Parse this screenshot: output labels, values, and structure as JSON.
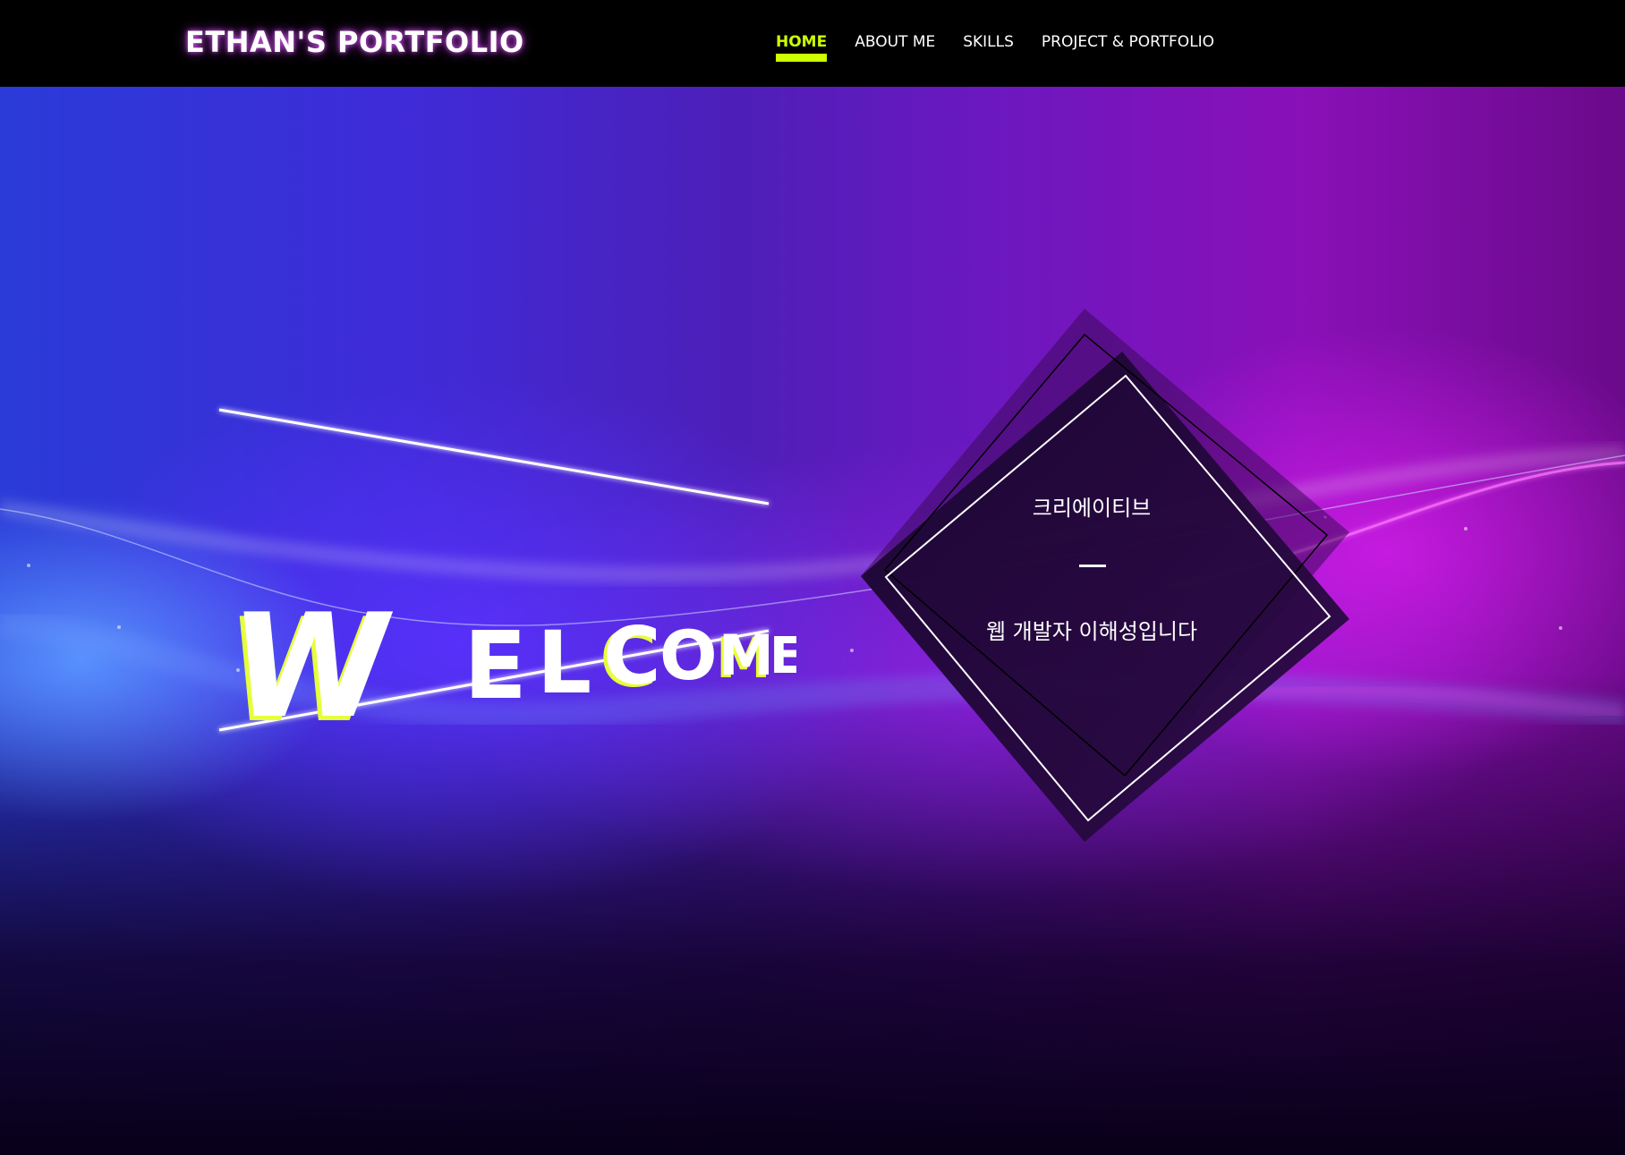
{
  "header": {
    "logo": "ETHAN'S PORTFOLIO",
    "nav": [
      {
        "label": "HOME",
        "active": true
      },
      {
        "label": "ABOUT ME",
        "active": false
      },
      {
        "label": "SKILLS",
        "active": false
      },
      {
        "label": "PROJECT & PORTFOLIO",
        "active": false
      }
    ]
  },
  "hero": {
    "welcome_letters": [
      "W",
      "E",
      "L",
      "C",
      "O",
      "M",
      "E"
    ],
    "diamond": {
      "title": "크리에이티브",
      "subtitle": "웹 개발자 이해성입니다"
    }
  },
  "colors": {
    "accent": "#ccff00",
    "text": "#ffffff",
    "header_bg": "#000000",
    "glow": "#e963ff"
  }
}
